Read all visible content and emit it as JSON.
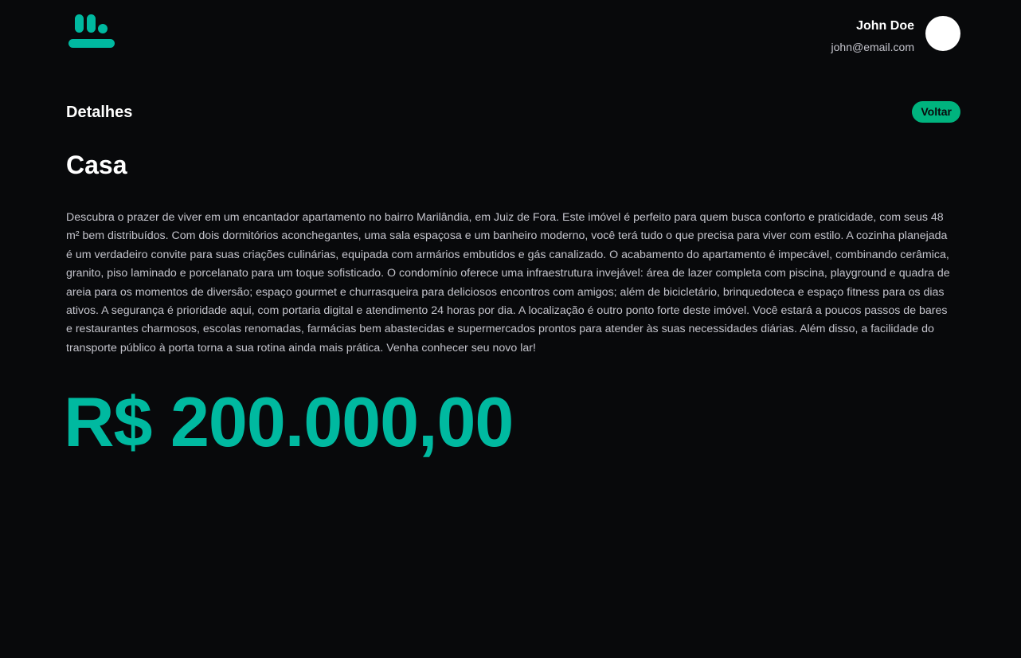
{
  "header": {
    "logo_icon": "brand-logo-icon",
    "user": {
      "name": "John Doe",
      "email": "john@email.com",
      "avatar_icon": "avatar-circle"
    }
  },
  "main": {
    "section_title": "Detalhes",
    "back_label": "Voltar",
    "property": {
      "title": "Casa",
      "description": "Descubra o prazer de viver em um encantador apartamento no bairro Marilândia, em Juiz de Fora. Este imóvel é perfeito para quem busca conforto e praticidade, com seus 48 m² bem distribuídos. Com dois dormitórios aconchegantes, uma sala espaçosa e um banheiro moderno, você terá tudo o que precisa para viver com estilo. A cozinha planejada é um verdadeiro convite para suas criações culinárias, equipada com armários embutidos e gás canalizado. O acabamento do apartamento é impecável, combinando cerâmica, granito, piso laminado e porcelanato para um toque sofisticado. O condomínio oferece uma infraestrutura invejável: área de lazer completa com piscina, playground e quadra de areia para os momentos de diversão; espaço gourmet e churrasqueira para deliciosos encontros com amigos; além de bicicletário, brinquedoteca e espaço fitness para os dias ativos. A segurança é prioridade aqui, com portaria digital e atendimento 24 horas por dia.  A localização é outro ponto forte deste imóvel. Você estará a poucos passos de bares e restaurantes charmosos, escolas renomadas, farmácias bem abastecidas e supermercados prontos para atender às suas necessidades diárias. Além disso, a facilidade do transporte público à porta torna a sua rotina ainda mais prática. Venha conhecer seu novo lar!",
      "price": "R$ 200.000,00"
    }
  },
  "colors": {
    "background": "#08090b",
    "accent": "#00b37e",
    "price": "#00b9a0",
    "text_primary": "#ffffff",
    "text_secondary": "#c4c4cc"
  }
}
